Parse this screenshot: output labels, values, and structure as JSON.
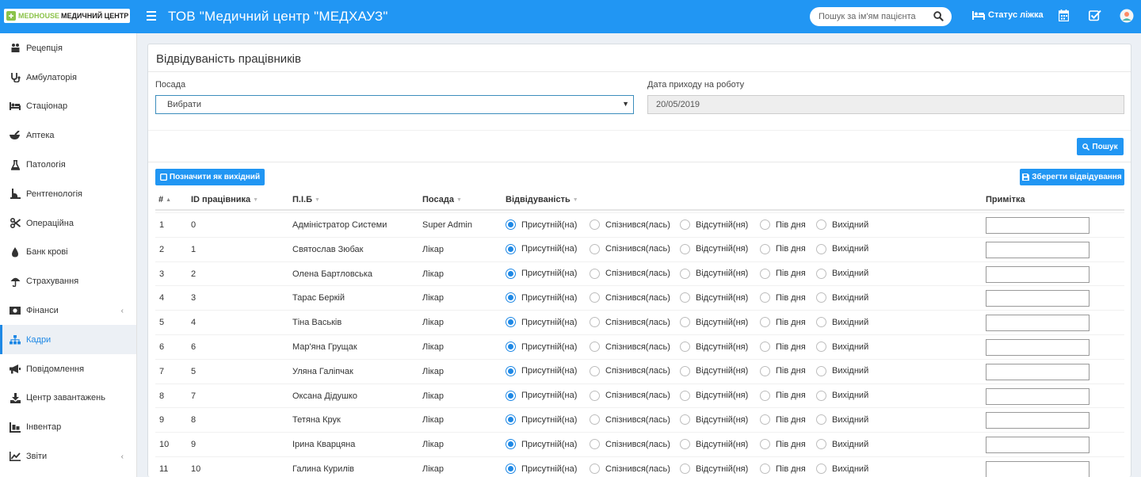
{
  "header": {
    "logo_brand": "MEDHOUSE",
    "logo_text": "МЕДИЧНИЙ ЦЕНТР",
    "title": "ТОВ \"Медичний центр \"МЕДХАУЗ\"",
    "search_placeholder": "Пошук за ім'ям пацієнта",
    "bed_status": "Статус ліжка",
    "icons": [
      "menu-icon",
      "search-icon",
      "bed-icon",
      "calendar-icon",
      "checkbox-icon",
      "user-avatar-icon"
    ],
    "accent_color": "#2196f3"
  },
  "sidebar": {
    "items": [
      {
        "label": "Рецепція",
        "icon": "reception-icon"
      },
      {
        "label": "Амбулаторія",
        "icon": "stethoscope-icon"
      },
      {
        "label": "Стаціонар",
        "icon": "bed-icon"
      },
      {
        "label": "Аптека",
        "icon": "mortar-icon"
      },
      {
        "label": "Патологія",
        "icon": "flask-icon"
      },
      {
        "label": "Рентгенологія",
        "icon": "xray-icon"
      },
      {
        "label": "Операційна",
        "icon": "scissors-icon"
      },
      {
        "label": "Банк крові",
        "icon": "blood-drop-icon"
      },
      {
        "label": "Страхування",
        "icon": "umbrella-icon"
      },
      {
        "label": "Фінанси",
        "icon": "money-icon",
        "has_children": true
      },
      {
        "label": "Кадри",
        "icon": "sitemap-icon",
        "active": true
      },
      {
        "label": "Повідомлення",
        "icon": "bullhorn-icon"
      },
      {
        "label": "Центр завантажень",
        "icon": "download-icon"
      },
      {
        "label": "Інвентар",
        "icon": "inventory-icon"
      },
      {
        "label": "Звіти",
        "icon": "chart-icon",
        "has_children": true
      }
    ]
  },
  "main": {
    "title": "Відвідуваність працівників",
    "position_label": "Посада",
    "position_value": "Вибрати",
    "date_label": "Дата приходу на роботу",
    "date_value": "20/05/2019",
    "search_button": "Пошук",
    "mark_holiday_button": "Позначити як вихідний",
    "save_button": "Зберегти відвідування",
    "columns": [
      "#",
      "ID працівника",
      "П.І.Б",
      "Посада",
      "Відвідуваність",
      "Примітка"
    ],
    "attendance_options": [
      "Присутній(на)",
      "Спізнився(лась)",
      "Відсутній(ня)",
      "Пів дня",
      "Вихідний"
    ],
    "rows": [
      {
        "n": "1",
        "id": "0",
        "name": "Адміністратор Системи",
        "role": "Super Admin",
        "selected": 0
      },
      {
        "n": "2",
        "id": "1",
        "name": "Святослав Зюбак",
        "role": "Лікар",
        "selected": 0
      },
      {
        "n": "3",
        "id": "2",
        "name": "Олена Бартловська",
        "role": "Лікар",
        "selected": 0
      },
      {
        "n": "4",
        "id": "3",
        "name": "Тарас Беркій",
        "role": "Лікар",
        "selected": 0
      },
      {
        "n": "5",
        "id": "4",
        "name": "Тіна Васьків",
        "role": "Лікар",
        "selected": 0
      },
      {
        "n": "6",
        "id": "6",
        "name": "Мар'яна Грущак",
        "role": "Лікар",
        "selected": 0
      },
      {
        "n": "7",
        "id": "5",
        "name": "Уляна Галіпчак",
        "role": "Лікар",
        "selected": 0
      },
      {
        "n": "8",
        "id": "7",
        "name": "Оксана Дідушко",
        "role": "Лікар",
        "selected": 0
      },
      {
        "n": "9",
        "id": "8",
        "name": "Тетяна Крук",
        "role": "Лікар",
        "selected": 0
      },
      {
        "n": "10",
        "id": "9",
        "name": "Ірина Кварцяна",
        "role": "Лікар",
        "selected": 0
      },
      {
        "n": "11",
        "id": "10",
        "name": "Галина Курилів",
        "role": "Лікар",
        "selected": 0
      }
    ]
  }
}
